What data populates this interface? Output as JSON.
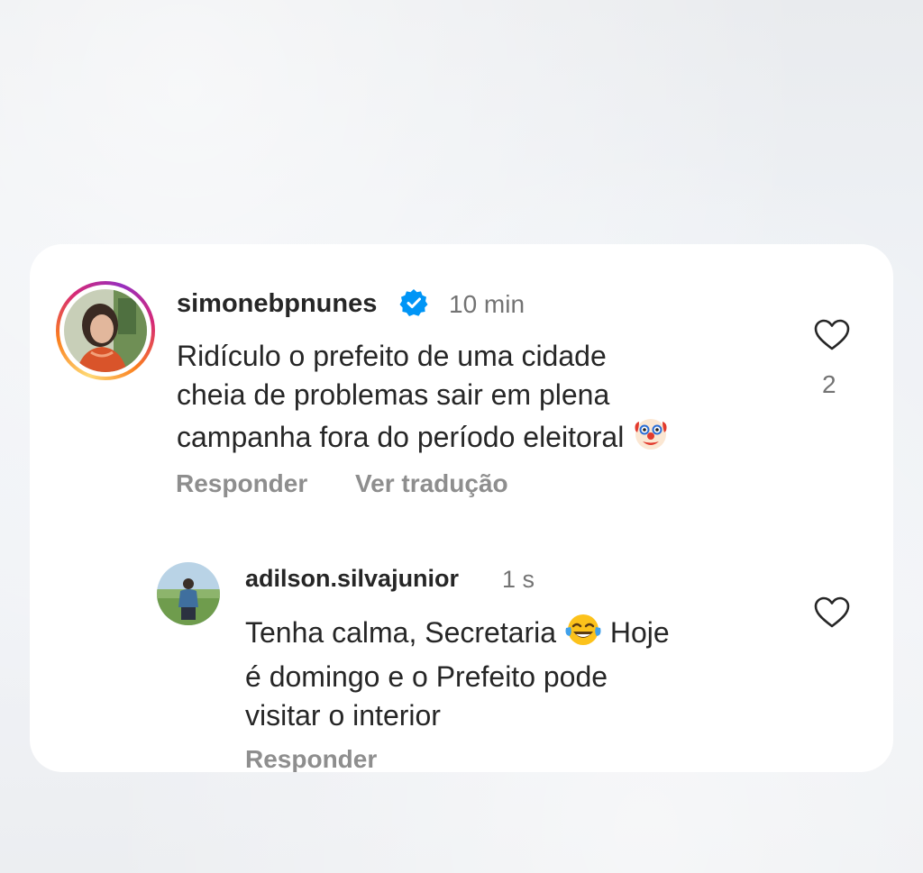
{
  "comments": [
    {
      "username": "simonebpnunes",
      "verified": true,
      "time": "10 min",
      "text_lines": [
        "Ridículo o prefeito de uma cidade",
        "cheia de problemas sair em plena",
        "campanha fora do período eleitoral"
      ],
      "emoji": "clown-face",
      "likes": "2",
      "actions": {
        "reply": "Responder",
        "translate": "Ver tradução"
      },
      "has_story_ring": true
    },
    {
      "username": "adilson.silvajunior",
      "verified": false,
      "time": "1 s",
      "text_line1": "Tenha calma, Secretaria",
      "text_line1_after": " Hoje",
      "text_lines_rest": [
        "é domingo e o Prefeito pode",
        "visitar o interior"
      ],
      "emoji": "face-with-tears-of-joy",
      "actions": {
        "reply": "Responder"
      },
      "has_story_ring": false
    }
  ],
  "colors": {
    "text": "#262626",
    "secondary": "#737373",
    "action": "#8e8e8e",
    "verified_badge": "#0095f6",
    "card_bg": "#ffffff"
  },
  "icons": [
    "heart-icon",
    "verified-badge-icon",
    "clown-face-emoji",
    "tears-of-joy-emoji"
  ]
}
